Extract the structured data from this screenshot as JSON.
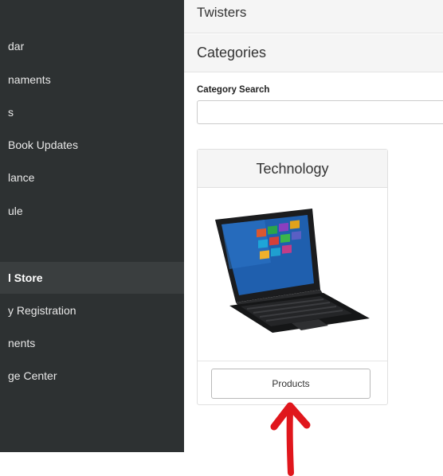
{
  "header": {
    "title": "Twisters"
  },
  "sidebar": {
    "items": [
      {
        "label": "dar",
        "active": false
      },
      {
        "label": "naments",
        "active": false
      },
      {
        "label": "s",
        "active": false
      },
      {
        "label": "Book Updates",
        "active": false
      },
      {
        "label": "lance",
        "active": false
      },
      {
        "label": "ule",
        "active": false
      },
      {
        "label": "",
        "active": false
      },
      {
        "label": "l Store",
        "active": true
      },
      {
        "label": "y Registration",
        "active": false
      },
      {
        "label": "nents",
        "active": false
      },
      {
        "label": "ge Center",
        "active": false
      }
    ]
  },
  "categories": {
    "title": "Categories",
    "search_label": "Category Search",
    "search_value": "",
    "search_placeholder": ""
  },
  "card": {
    "title": "Technology",
    "image_icon": "laptop-image",
    "button_label": "Products"
  },
  "annotation": {
    "icon": "red-arrow-up-icon",
    "color": "#e0161c"
  },
  "colors": {
    "sidebar_bg": "#2d3132",
    "active_item_bg": "#3a3e3f"
  }
}
